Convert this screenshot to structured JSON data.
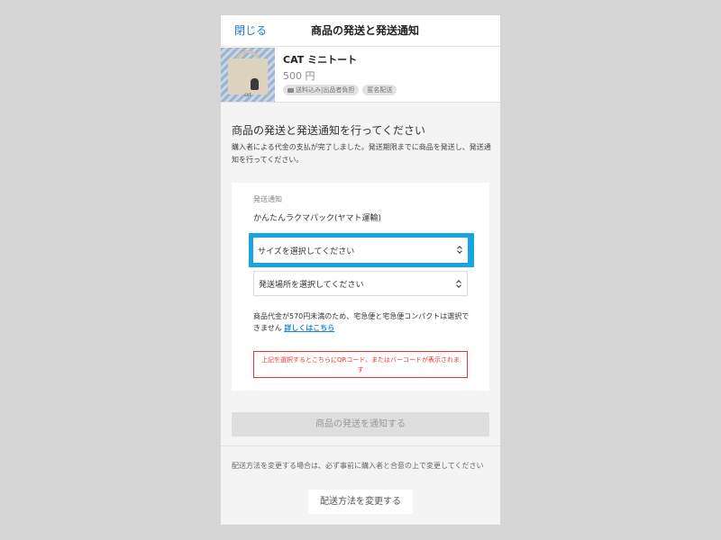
{
  "header": {
    "close_label": "閉じる",
    "title": "商品の発送と発送通知"
  },
  "item": {
    "name": "CAT ミニトート",
    "price": "500 円",
    "tags": [
      "送料込み|出品者負担",
      "匿名配送"
    ],
    "thumb_label": "CAT"
  },
  "section": {
    "title": "商品の発送と発送通知を行ってください",
    "description": "購入者による代金の支払が完了しました。発送期限までに商品を発送し、発送通知を行ってください。"
  },
  "form": {
    "label": "発送通知",
    "method": "かんたんラクマパック(ヤマト運輸)",
    "size_select_value": "サイズを選択してください",
    "place_select_value": "発送場所を選択してください",
    "note_text": "商品代金が570円未満のため、宅急便と宅急便コンパクトは選択できません",
    "note_link": "詳しくはこちら",
    "qr_notice": "上記を選択するとこちらにQRコード、またはバーコードが表示されます"
  },
  "actions": {
    "notify_label": "商品の発送を通知する",
    "bottom_note": "配送方法を変更する場合は、必ず事前に購入者と合意の上で変更してください",
    "change_label": "配送方法を変更する"
  },
  "colors": {
    "accent_link": "#1c77d6",
    "highlight": "#17a4e2",
    "error": "#ee3333"
  }
}
